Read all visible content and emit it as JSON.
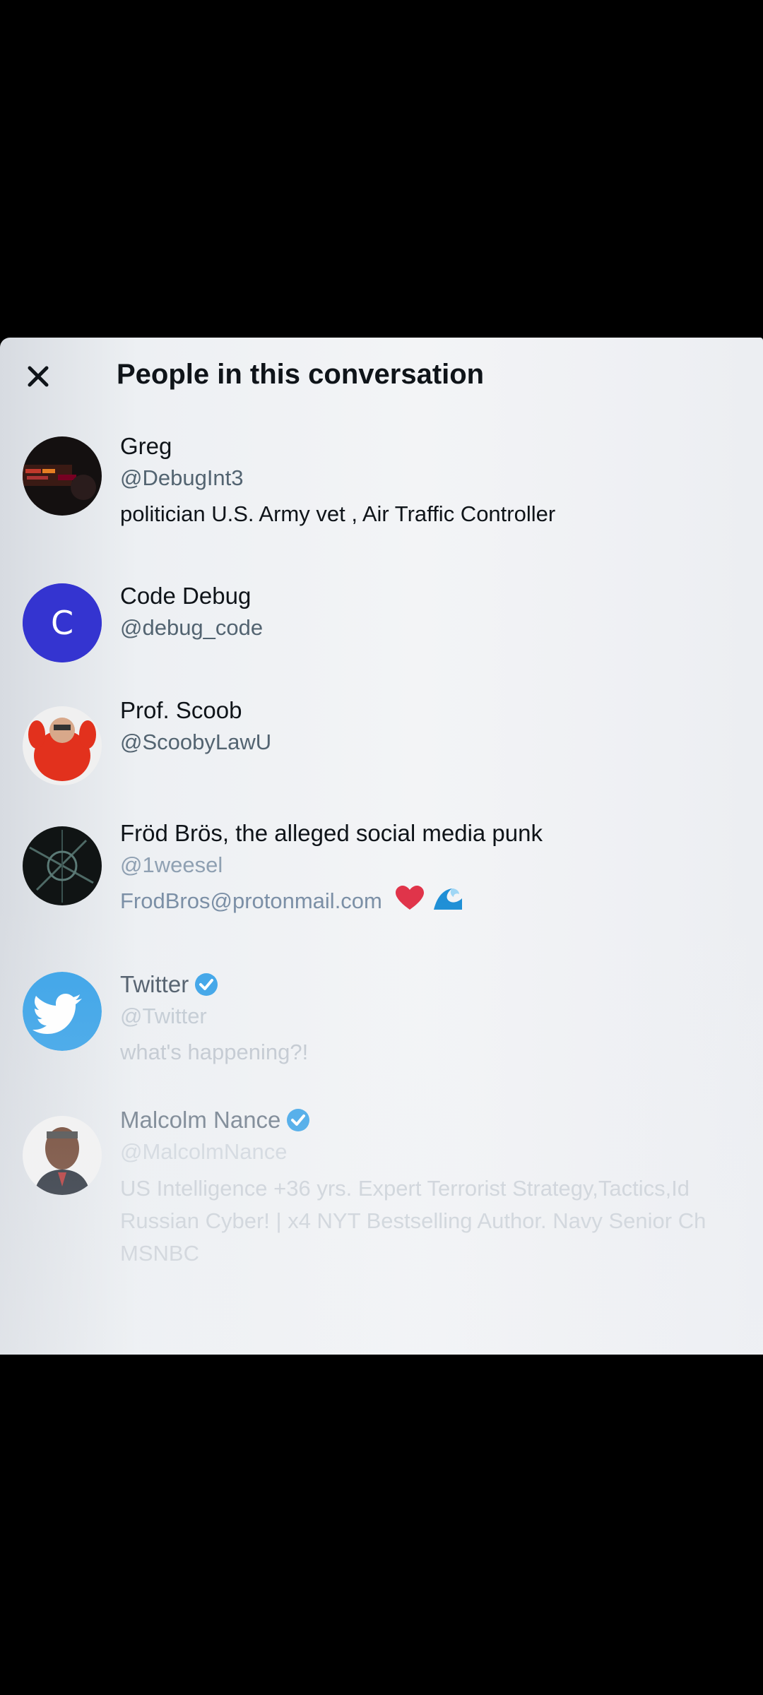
{
  "header": {
    "title": "People in this conversation",
    "close_icon": "close-icon"
  },
  "people": [
    {
      "name": "Greg",
      "handle": "@DebugInt3",
      "bio": "politician U.S. Army vet , Air Traffic Controller",
      "verified": false
    },
    {
      "name": "Code Debug",
      "handle": "@debug_code",
      "avatar_letter": "C",
      "avatar_color": "#3a3ad6",
      "verified": false
    },
    {
      "name": "Prof. Scoob",
      "handle": "@ScoobyLawU",
      "verified": false
    },
    {
      "name": "Fröd Brös, the alleged social media punk",
      "handle": "@1weesel",
      "bio": "FrodBros@protonmail.com",
      "bio_emojis": [
        "red-heart-icon",
        "wave-icon"
      ],
      "verified": false
    },
    {
      "name": "Twitter",
      "handle": "@Twitter",
      "bio": "what's happening?!",
      "verified": true,
      "avatar_color": "#1d9bf0"
    },
    {
      "name": "Malcolm Nance",
      "handle": "@MalcolmNance",
      "bio": "US Intelligence +36 yrs. Expert Terrorist Strategy,Tactics,Id Russian Cyber! | x4 NYT Bestselling Author. Navy Senior Ch MSNBC",
      "verified": true
    }
  ],
  "colors": {
    "verified_badge": "#1d9bf0",
    "text_primary": "#0f1419",
    "text_secondary": "#536471"
  }
}
